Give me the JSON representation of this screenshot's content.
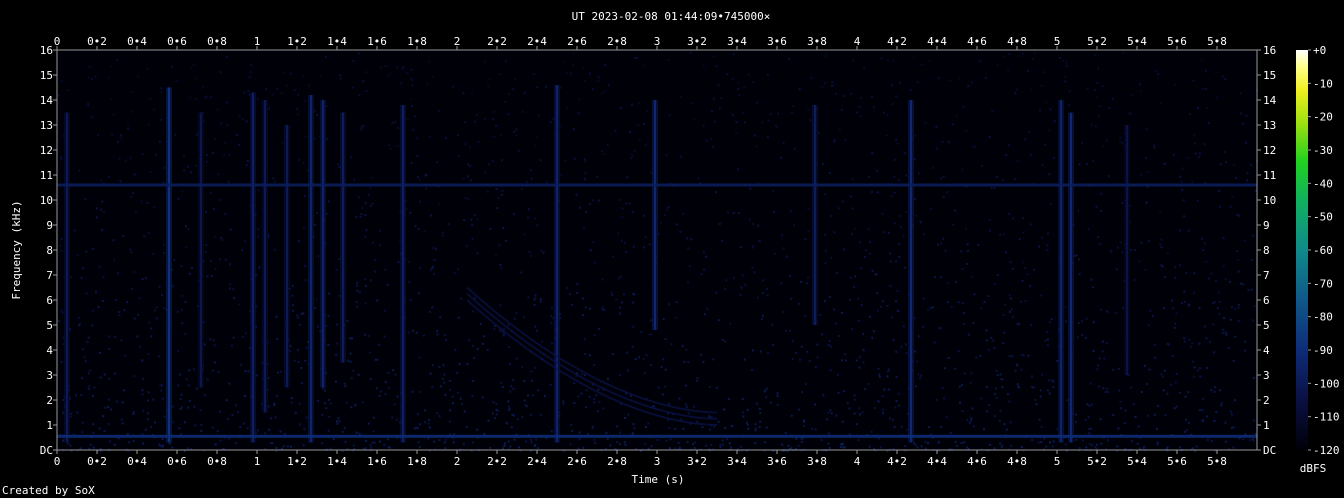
{
  "title": "UT 2023-02-08 01:44:09•745000×",
  "footer": "Created by SoX",
  "chart_data": {
    "type": "heatmap",
    "title": "UT 2023-02-08 01:44:09•745000×",
    "xlabel": "Time (s)",
    "ylabel": "Frequency (kHz)",
    "xlim": [
      0,
      5.98
    ],
    "ylim": [
      0,
      16
    ],
    "x_ticks": [
      "0",
      "0•2",
      "0•4",
      "0•6",
      "0•8",
      "1",
      "1•2",
      "1•4",
      "1•6",
      "1•8",
      "2",
      "2•2",
      "2•4",
      "2•6",
      "2•8",
      "3",
      "3•2",
      "3•4",
      "3•6",
      "3•8",
      "4",
      "4•2",
      "4•4",
      "4•6",
      "4•8",
      "5",
      "5•2",
      "5•4",
      "5•6",
      "5•8"
    ],
    "y_ticks": [
      "DC",
      "1",
      "2",
      "3",
      "4",
      "5",
      "6",
      "7",
      "8",
      "9",
      "10",
      "11",
      "12",
      "13",
      "14",
      "15",
      "16"
    ],
    "colorbar": {
      "label": "dBFS",
      "ticks": [
        "+0",
        "-10",
        "-20",
        "-30",
        "-40",
        "-50",
        "-60",
        "-70",
        "-80",
        "-90",
        "-100",
        "-110",
        "-120"
      ],
      "range": [
        -120,
        0
      ]
    },
    "background_level_dbfs": -112,
    "tone_lines": [
      {
        "freq_khz": 10.6,
        "level_dbfs": -98
      },
      {
        "freq_khz": 0.55,
        "level_dbfs": -90
      }
    ],
    "impulses": [
      {
        "t": 0.05,
        "f_lo": 0.3,
        "f_hi": 13.5,
        "level_dbfs": -100
      },
      {
        "t": 0.56,
        "f_lo": 0.3,
        "f_hi": 14.5,
        "level_dbfs": -88
      },
      {
        "t": 0.72,
        "f_lo": 2.5,
        "f_hi": 13.5,
        "level_dbfs": -102
      },
      {
        "t": 0.98,
        "f_lo": 0.3,
        "f_hi": 14.3,
        "level_dbfs": -96
      },
      {
        "t": 1.04,
        "f_lo": 1.5,
        "f_hi": 14.0,
        "level_dbfs": -100
      },
      {
        "t": 1.15,
        "f_lo": 2.5,
        "f_hi": 13.0,
        "level_dbfs": -100
      },
      {
        "t": 1.27,
        "f_lo": 0.3,
        "f_hi": 14.2,
        "level_dbfs": -94
      },
      {
        "t": 1.33,
        "f_lo": 2.5,
        "f_hi": 14.0,
        "level_dbfs": -94
      },
      {
        "t": 1.43,
        "f_lo": 3.5,
        "f_hi": 13.5,
        "level_dbfs": -98
      },
      {
        "t": 1.73,
        "f_lo": 0.3,
        "f_hi": 13.8,
        "level_dbfs": -96
      },
      {
        "t": 2.5,
        "f_lo": 0.3,
        "f_hi": 14.6,
        "level_dbfs": -94
      },
      {
        "t": 2.99,
        "f_lo": 4.8,
        "f_hi": 14.0,
        "level_dbfs": -92
      },
      {
        "t": 3.79,
        "f_lo": 5.0,
        "f_hi": 13.8,
        "level_dbfs": -98
      },
      {
        "t": 4.27,
        "f_lo": 0.3,
        "f_hi": 14.0,
        "level_dbfs": -92
      },
      {
        "t": 5.02,
        "f_lo": 0.3,
        "f_hi": 14.0,
        "level_dbfs": -94
      },
      {
        "t": 5.07,
        "f_lo": 0.3,
        "f_hi": 13.5,
        "level_dbfs": -92
      },
      {
        "t": 5.35,
        "f_lo": 3.0,
        "f_hi": 13.0,
        "level_dbfs": -104
      }
    ],
    "dispersive_sweep": {
      "t_start": 2.05,
      "t_end": 3.3,
      "f_start_khz": 6.5,
      "f_end_khz": 1.5,
      "level_dbfs": -104
    }
  }
}
